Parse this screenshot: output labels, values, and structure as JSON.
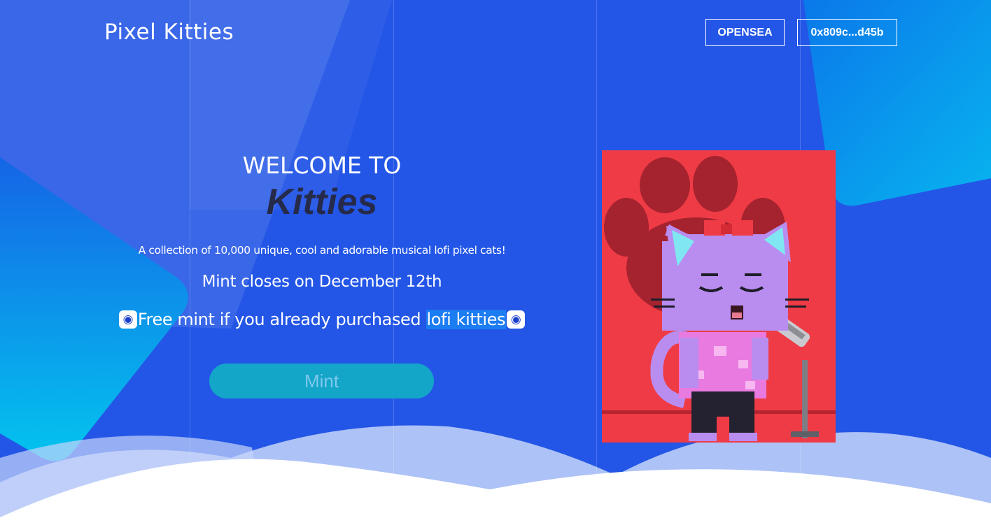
{
  "header": {
    "brand": "Pixel Kitties",
    "opensea_label": "OPENSEA",
    "wallet_label": "0x809c...d45b"
  },
  "hero": {
    "welcome": "WELCOME TO",
    "title": "Kitties",
    "description": "A collection of 10,000 unique, cool and adorable musical lofi pixel cats!",
    "mint_closes": "Mint closes on December 12th",
    "free_mint_before": "Free mint if you already purchased ",
    "free_mint_highlight": "lofi kitties",
    "mint_button": "Mint"
  },
  "icons": {
    "emoji": "screaming-face-icon",
    "artwork": "pixel-cat-singing-image"
  },
  "colors": {
    "background": "#2356e6",
    "art_background": "#ef3b45",
    "paw": "#a5232f",
    "cat": "#b98df0",
    "mint_button": "#13a6c8",
    "highlight": "#1c7cf2"
  }
}
